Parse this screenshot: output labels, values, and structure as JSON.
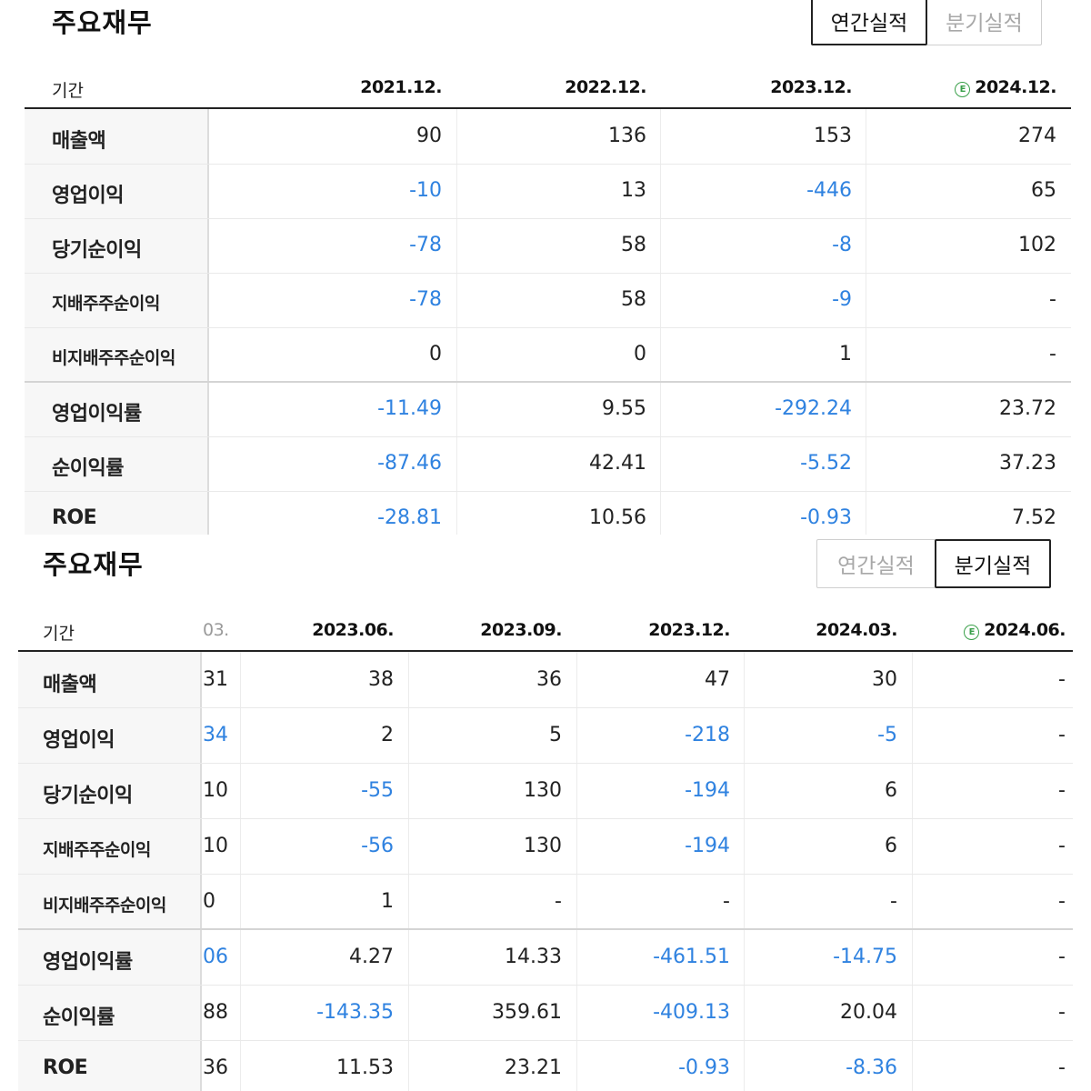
{
  "annual": {
    "title": "주요재무",
    "tabs": {
      "annual": "연간실적",
      "quarterly": "분기실적",
      "active": "annual"
    },
    "period_label": "기간",
    "columns": [
      "2021.12.",
      "2022.12.",
      "2023.12.",
      "2024.12."
    ],
    "estimate_marker": "E",
    "estimate_column": 3,
    "rows": [
      {
        "label": "매출액",
        "values": [
          "90",
          "136",
          "153",
          "274"
        ]
      },
      {
        "label": "영업이익",
        "values": [
          "-10",
          "13",
          "-446",
          "65"
        ]
      },
      {
        "label": "당기순이익",
        "values": [
          "-78",
          "58",
          "-8",
          "102"
        ]
      },
      {
        "label": "지배주주순이익",
        "values": [
          "-78",
          "58",
          "-9",
          "-"
        ]
      },
      {
        "label": "비지배주주순이익",
        "values": [
          "0",
          "0",
          "1",
          "-"
        ]
      },
      {
        "label": "영업이익률",
        "values": [
          "-11.49",
          "9.55",
          "-292.24",
          "23.72"
        ]
      },
      {
        "label": "순이익률",
        "values": [
          "-87.46",
          "42.41",
          "-5.52",
          "37.23"
        ]
      },
      {
        "label": "ROE",
        "values": [
          "-28.81",
          "10.56",
          "-0.93",
          "7.52"
        ]
      }
    ]
  },
  "quarterly": {
    "title": "주요재무",
    "tabs": {
      "annual": "연간실적",
      "quarterly": "분기실적",
      "active": "quarterly"
    },
    "period_label": "기간",
    "partial_column_header": "03.",
    "columns": [
      "2023.06.",
      "2023.09.",
      "2023.12.",
      "2024.03.",
      "2024.06."
    ],
    "estimate_marker": "E",
    "estimate_column": 4,
    "rows": [
      {
        "label": "매출액",
        "partial": "31",
        "values": [
          "38",
          "36",
          "47",
          "30",
          "-"
        ]
      },
      {
        "label": "영업이익",
        "partial": "34",
        "values": [
          "2",
          "5",
          "-218",
          "-5",
          "-"
        ]
      },
      {
        "label": "당기순이익",
        "partial": "10",
        "values": [
          "-55",
          "130",
          "-194",
          "6",
          "-"
        ]
      },
      {
        "label": "지배주주순이익",
        "partial": "10",
        "values": [
          "-56",
          "130",
          "-194",
          "6",
          "-"
        ]
      },
      {
        "label": "비지배주주순이익",
        "partial": "0",
        "values": [
          "1",
          "-",
          "-",
          "-",
          "-"
        ]
      },
      {
        "label": "영업이익률",
        "partial": "06",
        "values": [
          "4.27",
          "14.33",
          "-461.51",
          "-14.75",
          "-"
        ]
      },
      {
        "label": "순이익률",
        "partial": "88",
        "values": [
          "-143.35",
          "359.61",
          "-409.13",
          "20.04",
          "-"
        ]
      },
      {
        "label": "ROE",
        "partial": "36",
        "values": [
          "11.53",
          "23.21",
          "-0.93",
          "-8.36",
          "-"
        ]
      }
    ]
  },
  "colors": {
    "negative": "#2f82e0",
    "estimate": "#3aa04a",
    "text": "#222222"
  }
}
